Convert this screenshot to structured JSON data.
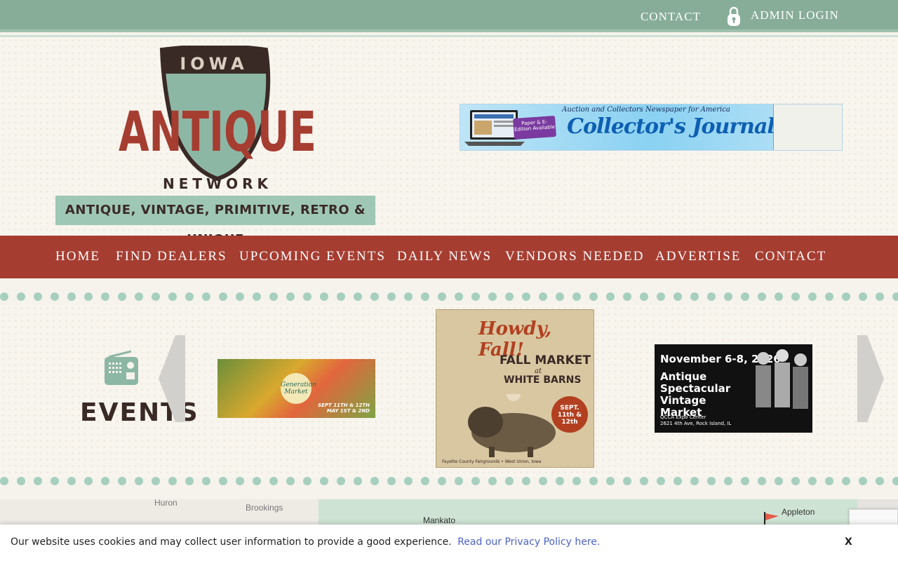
{
  "topbar": {
    "contact_label": "CONTACT",
    "admin_label": "ADMIN LOGIN",
    "lock_icon": "lock-icon",
    "bg_color": "#87ad99"
  },
  "header": {
    "logo_top": "IOWA",
    "logo_main": "ANTIQUE",
    "logo_bottom": "NETWORK",
    "tagline": "ANTIQUE, VINTAGE, PRIMITIVE, RETRO & UNIQUE",
    "banner": {
      "top_text": "Auction and Collectors Newspaper for America",
      "badge": "Paper & E-Edition Available",
      "title": "Collector's Journal"
    }
  },
  "nav": {
    "bg_color": "#a63d31",
    "items": [
      {
        "label": "HOME"
      },
      {
        "label": "FIND DEALERS"
      },
      {
        "label": "UPCOMING EVENTS"
      },
      {
        "label": "DAILY NEWS"
      },
      {
        "label": "VENDORS NEEDED"
      },
      {
        "label": "ADVERTISE"
      },
      {
        "label": "CONTACT"
      }
    ]
  },
  "events": {
    "heading": "EVENTS",
    "icon": "radio-icon",
    "cards": [
      {
        "logo": "Generation Market",
        "dates": "SEPT 11TH & 12TH\nMAY 1ST & 2ND"
      },
      {
        "title": "Howdy, Fall!",
        "subtitle": "FALL MARKET",
        "at": "at",
        "venue": "WHITE BARNS",
        "dates": "SEPT. 11th & 12th",
        "footer": "Fayette County Fairgrounds • West Union, Iowa"
      },
      {
        "date_line": "November 6-8, 2026",
        "title": "Antique Spectacular Vintage Market",
        "venue": "QCCA Expo Center",
        "address": "2621 4th Ave, Rock Island, IL"
      }
    ]
  },
  "map": {
    "towns": [
      "Huron",
      "Brookings",
      "Mankato",
      "Appleton"
    ]
  },
  "cookie": {
    "message": "Our website uses cookies and may collect user information to provide a good experience.",
    "policy_link": "Read our Privacy Policy here.",
    "close_label": "X"
  }
}
